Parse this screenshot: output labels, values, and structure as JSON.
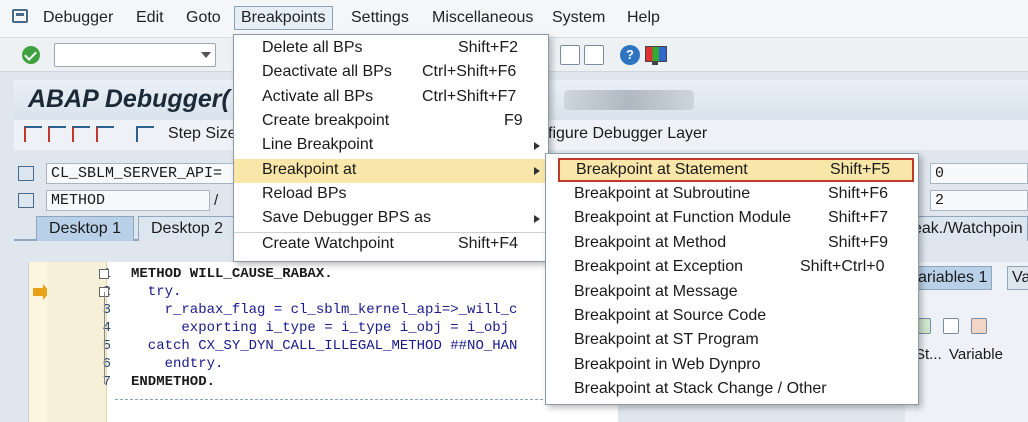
{
  "menubar": {
    "items": [
      "Debugger",
      "Edit",
      "Goto",
      "Breakpoints",
      "Settings",
      "Miscellaneous",
      "System",
      "Help"
    ]
  },
  "title": {
    "text": "ABAP Debugger("
  },
  "app_toolbar": {
    "step_size": "Step Size",
    "configure_layer": "figure Debugger Layer"
  },
  "fields": {
    "program": "CL_SBLM_SERVER_API=",
    "method_type": "METHOD",
    "slash": "/",
    "right_value_1": "0",
    "right_value_2": "2"
  },
  "tabs": {
    "desktop1": "Desktop 1",
    "desktop2": "Desktop 2",
    "watchpoints": "eak./Watchpoin"
  },
  "right_panel": {
    "tab_variables": "ariables 1",
    "tab_va": "Va",
    "col_st": "St...",
    "col_variable": "Variable"
  },
  "breakpoints_menu": {
    "items": [
      {
        "label": "Delete all BPs",
        "shortcut": "Shift+F2"
      },
      {
        "label": "Deactivate all BPs",
        "shortcut": "Ctrl+Shift+F6"
      },
      {
        "label": "Activate all BPs",
        "shortcut": "Ctrl+Shift+F7"
      },
      {
        "label": "Create breakpoint",
        "shortcut": "F9"
      },
      {
        "label": "Line Breakpoint",
        "shortcut": ""
      },
      {
        "label": "Breakpoint at",
        "shortcut": ""
      },
      {
        "label": "Reload BPs",
        "shortcut": ""
      },
      {
        "label": "Save Debugger BPS as",
        "shortcut": ""
      },
      {
        "label": "Create Watchpoint",
        "shortcut": "Shift+F4"
      }
    ]
  },
  "breakpoint_at_submenu": {
    "items": [
      {
        "label": "Breakpoint at Statement",
        "shortcut": "Shift+F5"
      },
      {
        "label": "Breakpoint at Subroutine",
        "shortcut": "Shift+F6"
      },
      {
        "label": "Breakpoint at Function Module",
        "shortcut": "Shift+F7"
      },
      {
        "label": "Breakpoint at Method",
        "shortcut": "Shift+F9"
      },
      {
        "label": "Breakpoint at Exception",
        "shortcut": "Shift+Ctrl+0"
      },
      {
        "label": "Breakpoint at Message",
        "shortcut": ""
      },
      {
        "label": "Breakpoint at Source Code",
        "shortcut": ""
      },
      {
        "label": "Breakpoint at ST Program",
        "shortcut": ""
      },
      {
        "label": "Breakpoint in Web Dynpro",
        "shortcut": ""
      },
      {
        "label": "Breakpoint at Stack Change / Other",
        "shortcut": ""
      }
    ]
  },
  "editor": {
    "line_numbers": [
      "1",
      "2",
      "3",
      "4",
      "5",
      "6",
      "7"
    ],
    "lines": [
      "METHOD WILL_CAUSE_RABAX.",
      "  try.",
      "    r_rabax_flag = cl_sblm_kernel_api=>_will_c",
      "      exporting i_type = i_type i_obj = i_obj",
      "  catch CX_SY_DYN_CALL_ILLEGAL_METHOD ##NO_HAN",
      "    endtry.",
      "ENDMETHOD."
    ]
  }
}
